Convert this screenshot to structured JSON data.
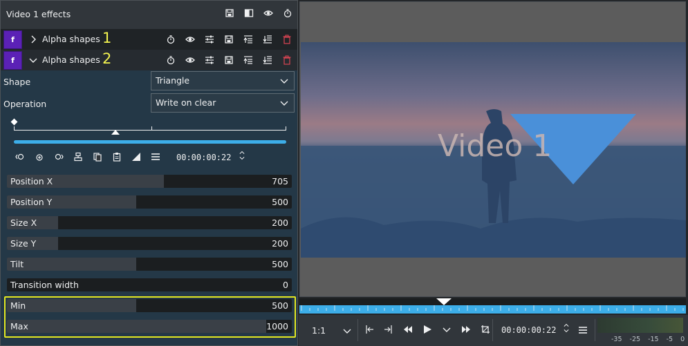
{
  "effects_panel": {
    "title": "Video 1 effects",
    "header_icons": [
      "save-icon",
      "compare-icon",
      "eye-icon",
      "timer-icon"
    ],
    "effects": [
      {
        "badge": "f",
        "name": "Alpha shapes",
        "expanded": false,
        "annotation": "1"
      },
      {
        "badge": "f",
        "name": "Alpha shapes",
        "expanded": true,
        "annotation": "2"
      }
    ],
    "row_icons": [
      "timer-icon",
      "eye-icon",
      "sliders-icon",
      "save-icon",
      "collapse-icon",
      "move-down-icon",
      "delete-icon"
    ],
    "shape": {
      "label": "Shape",
      "value": "Triangle"
    },
    "operation": {
      "label": "Operation",
      "value": "Write on clear"
    },
    "keyframe_time": "00:00:00:22",
    "keyframe_icons": [
      "prev-keyframe-icon",
      "add-keyframe-icon",
      "next-keyframe-icon",
      "align-icon",
      "copy-icon",
      "paste-icon",
      "interpolation-icon",
      "menu-icon"
    ],
    "params": [
      {
        "label": "Position X",
        "value": "705",
        "fill": 0.55
      },
      {
        "label": "Position Y",
        "value": "500",
        "fill": 0.455
      },
      {
        "label": "Size X",
        "value": "200",
        "fill": 0.18
      },
      {
        "label": "Size Y",
        "value": "200",
        "fill": 0.18
      },
      {
        "label": "Tilt",
        "value": "500",
        "fill": 0.455
      },
      {
        "label": "Transition width",
        "value": "0",
        "fill": 0.0
      },
      {
        "label": "Min",
        "value": "500",
        "fill": 0.455
      },
      {
        "label": "Max",
        "value": "1000",
        "fill": 0.91
      }
    ]
  },
  "monitor": {
    "overlay_text": "Video 1",
    "zoom": "1:1",
    "timecode": "00:00:00:22",
    "audio_ticks": [
      "-35",
      "-25",
      "-15",
      "-5",
      "0"
    ]
  },
  "colors": {
    "accent": "#3daee9",
    "highlight": "#e4e821",
    "badge": "#5b21b6",
    "delete": "#da4453",
    "triangle": "#4a90d9"
  }
}
